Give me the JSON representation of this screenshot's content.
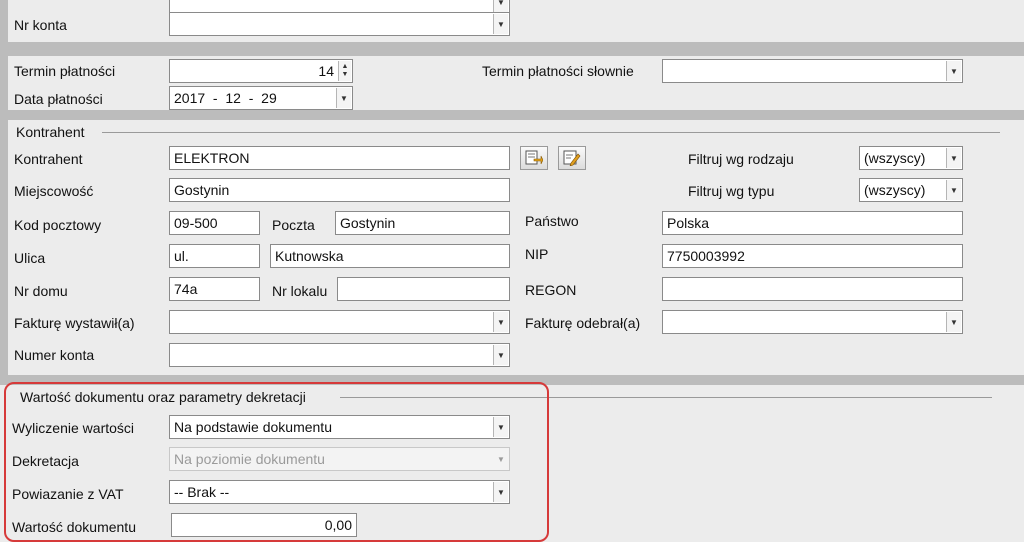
{
  "top": {
    "account_label": "Nr konta",
    "account_value": ""
  },
  "payment": {
    "term_label": "Termin płatności",
    "term_value": "14",
    "term_words_label": "Termin płatności słownie",
    "term_words_value": "",
    "date_label": "Data płatności",
    "date_value": "2017  -  12  -  29"
  },
  "contractor": {
    "section_title": "Kontrahent",
    "name_label": "Kontrahent",
    "name_value": "ELEKTRON",
    "city_label": "Miejscowość",
    "city_value": "Gostynin",
    "postal_label": "Kod pocztowy",
    "postal_value": "09-500",
    "post_label": "Poczta",
    "post_value": "Gostynin",
    "country_label": "Państwo",
    "country_value": "Polska",
    "street_label": "Ulica",
    "street_prefix": "ul.",
    "street_value": "Kutnowska",
    "nip_label": "NIP",
    "nip_value": "7750003992",
    "house_label": "Nr domu",
    "house_value": "74a",
    "flat_label": "Nr lokalu",
    "flat_value": "",
    "regon_label": "REGON",
    "regon_value": "",
    "issued_by_label": "Fakturę wystawił(a)",
    "issued_by_value": "",
    "received_by_label": "Fakturę odebrał(a)",
    "received_by_value": "",
    "account_label": "Numer konta",
    "account_value": "",
    "filter_kind_label": "Filtruj wg rodzaju",
    "filter_kind_value": "(wszyscy)",
    "filter_type_label": "Filtruj wg typu",
    "filter_type_value": "(wszyscy)",
    "icons": [
      "select-contractor-icon",
      "edit-contractor-icon"
    ]
  },
  "document_value": {
    "section_title": "Wartość dokumentu oraz parametry dekretacji",
    "calc_label": "Wyliczenie wartości",
    "calc_value": "Na podstawie dokumentu",
    "decree_label": "Dekretacja",
    "decree_value": "Na poziomie dokumentu",
    "vat_label": "Powiazanie z VAT",
    "vat_value": "-- Brak --",
    "value_label": "Wartość dokumentu",
    "value_value": "0,00"
  },
  "colors": {
    "highlight": "#d63a3a",
    "band": "#bcbcbc",
    "panel": "#ececec"
  }
}
